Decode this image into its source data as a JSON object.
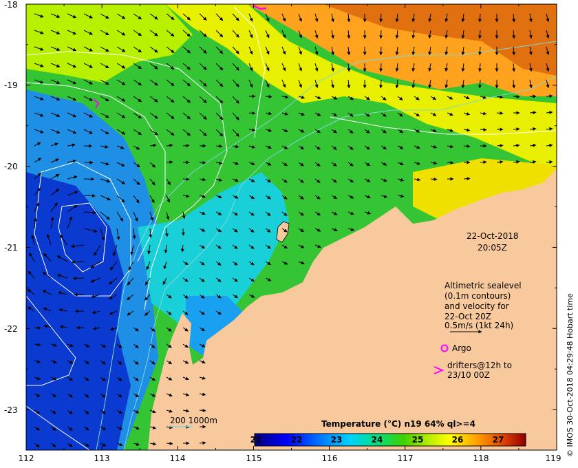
{
  "map": {
    "lon_range": [
      112,
      119
    ],
    "lat_range": [
      -23.5,
      -18
    ],
    "x_ticks": [
      "112",
      "113",
      "114",
      "115",
      "116",
      "117",
      "118",
      "119"
    ],
    "y_ticks": [
      "-18",
      "-19",
      "-20",
      "-21",
      "-22",
      "-23"
    ],
    "land_color": "#f7c99d"
  },
  "timestamp": {
    "date": "22-Oct-2018",
    "time": "20:05Z"
  },
  "legend": {
    "line1": "Altimetric sealevel",
    "line2": "(0.1m contours)",
    "line3": "and velocity for",
    "line4": "22-Oct 20Z",
    "line5": "0.5m/s (1kt 24h)",
    "argo": "Argo",
    "drifters1": "drifters@12h to",
    "drifters2": "23/10 00Z",
    "argo_color": "#ff00ff",
    "drifter_color": "#ff00ff"
  },
  "bathymetry": {
    "label": "200  1000m",
    "color": "#7fd7d7"
  },
  "colorbar": {
    "title": "Temperature (°C) n19 64% ql>=4",
    "ticks": [
      "21",
      "22",
      "23",
      "24",
      "25",
      "26",
      "27"
    ],
    "range": [
      21,
      27.7
    ]
  },
  "credit": "© IMOS 30-Oct-2018 04:29:48 Hobart time"
}
